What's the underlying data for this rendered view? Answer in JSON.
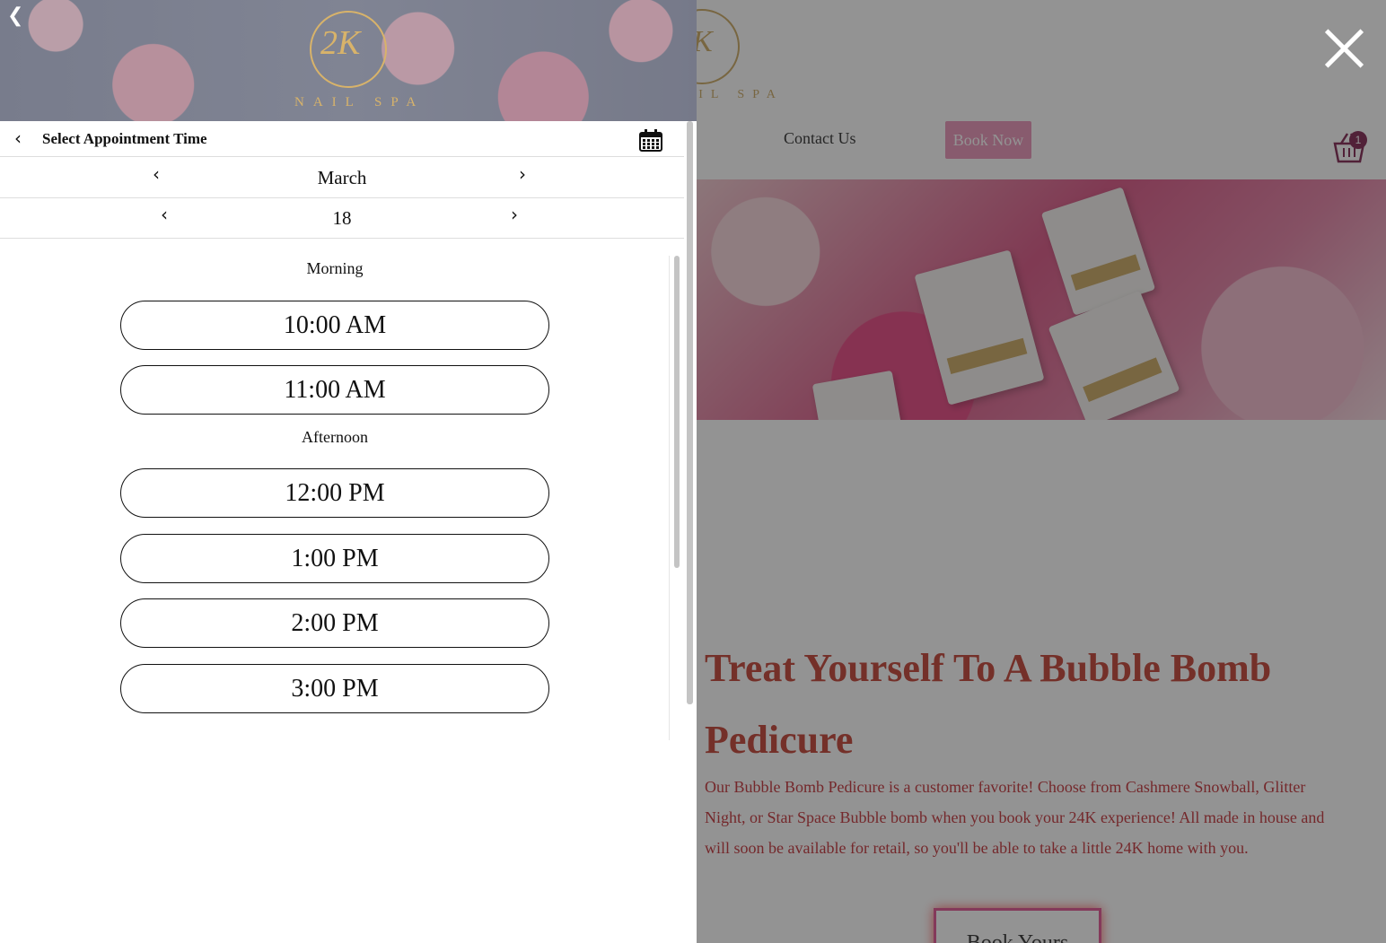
{
  "background_page": {
    "logo_text": "NAIL SPA",
    "logo_monogram": "2K",
    "nav_contact": "Contact Us",
    "nav_book_now": "Book Now",
    "cart_count": "1",
    "heading": "Treat Yourself To A Bubble Bomb Pedicure",
    "paragraph": "Our Bubble Bomb Pedicure is a customer favorite! Choose from Cashmere Snowball, Glitter Night, or Star Space Bubble bomb when you book your 24K experience! All made in house and will soon be available for retail, so you'll be able to take a little 24K home with you.",
    "book_yours": "Book Yours"
  },
  "panel": {
    "logo_monogram": "2K",
    "logo_text": "NAIL SPA",
    "title": "Select Appointment Time",
    "month": "March",
    "day": "18",
    "sections": [
      {
        "label": "Morning",
        "slots": [
          "10:00 AM",
          "11:00 AM"
        ]
      },
      {
        "label": "Afternoon",
        "slots": [
          "12:00 PM",
          "1:00 PM",
          "2:00 PM",
          "3:00 PM"
        ]
      }
    ]
  },
  "colors": {
    "accent_gold": "#d8b36a",
    "heading_red": "#c0392b",
    "book_now_pink": "#e88fb5"
  },
  "icons": [
    "chevron-left-icon",
    "chevron-right-icon",
    "calendar-icon",
    "close-icon",
    "basket-icon"
  ]
}
